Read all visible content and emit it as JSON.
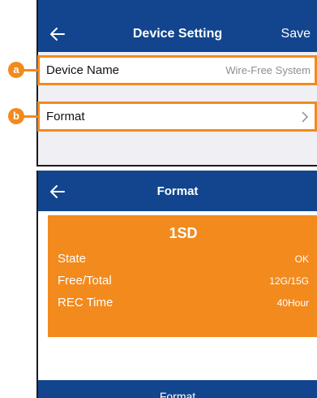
{
  "device_setting": {
    "title": "Device Setting",
    "save_label": "Save",
    "rows": [
      {
        "label": "Device Name",
        "value": "Wire-Free System",
        "callout": "a"
      },
      {
        "label": "Format",
        "callout": "b"
      }
    ]
  },
  "format_screen": {
    "title": "Format",
    "card": {
      "title": "1SD",
      "rows": [
        {
          "label": "State",
          "value": "OK"
        },
        {
          "label": "Free/Total",
          "value": "12G/15G"
        },
        {
          "label": "REC Time",
          "value": "40Hour"
        }
      ]
    },
    "format_button_label": "Format"
  },
  "colors": {
    "nav_blue": "#12458e",
    "accent_orange": "#f28a1e"
  },
  "icons": [
    "back-arrow-icon",
    "chevron-right-icon"
  ]
}
